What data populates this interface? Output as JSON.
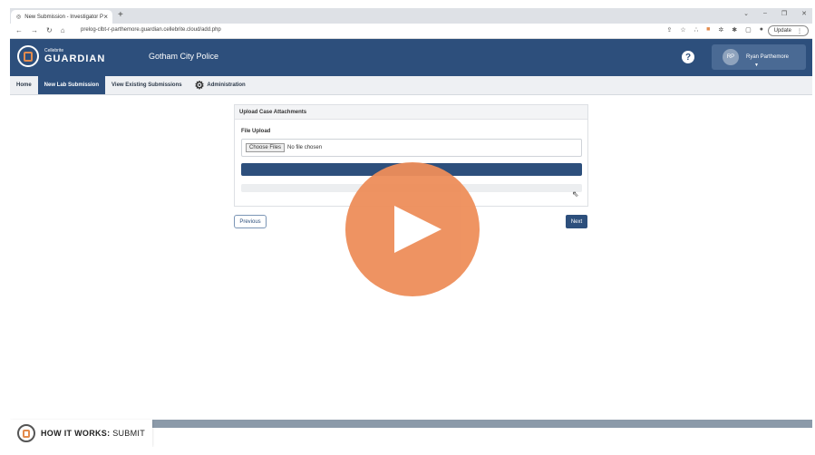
{
  "browser": {
    "tab_title": "New Submission - Investigator P",
    "tab_close": "×",
    "new_tab": "+",
    "url": "prelog-clbt-r-parthemore.guardian.cellebrite.cloud/add.php",
    "update_label": "Update"
  },
  "header": {
    "brand_small": "Cellebrite",
    "brand_big": "GUARDIAN",
    "org_name": "Gotham City Police",
    "help": "?",
    "user_initials": "RP",
    "user_name": "Ryan Parthemore"
  },
  "nav": {
    "items": [
      {
        "label": "Home"
      },
      {
        "label": "New Lab Submission"
      },
      {
        "label": "View Existing Submissions"
      },
      {
        "label": "Administration"
      }
    ]
  },
  "panel": {
    "title": "Upload Case Attachments",
    "field_label": "File Upload",
    "choose_label": "Choose Files",
    "no_file_text": "No file chosen"
  },
  "buttons": {
    "previous": "Previous",
    "next": "Next"
  },
  "overlay": {
    "badge_bold": "HOW IT WORKS:",
    "badge_rest": " SUBMIT"
  },
  "colors": {
    "primary": "#2d4f7c",
    "play": "#ee8e5a"
  }
}
